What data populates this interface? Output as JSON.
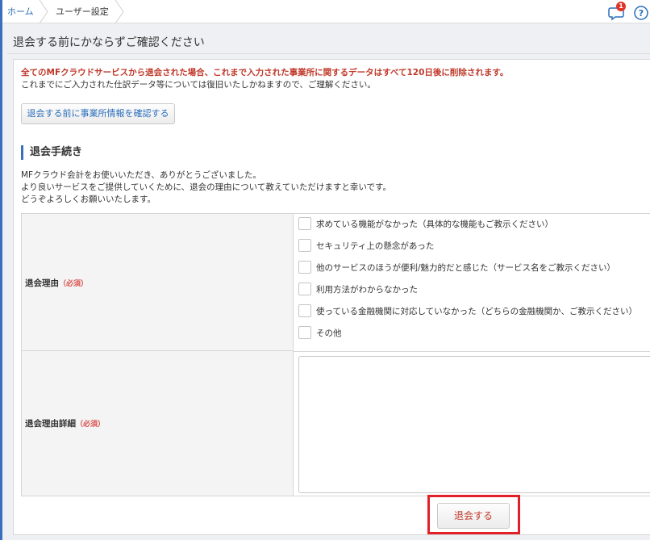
{
  "breadcrumb": {
    "home": "ホーム",
    "current": "ユーザー設定"
  },
  "header": {
    "notification_count": "1",
    "help_label": "?"
  },
  "page": {
    "title": "退会する前にかならずご確認ください"
  },
  "notice": {
    "warning": "全てのMFクラウドサービスから退会された場合、これまで入力された事業所に関するデータはすべて120日後に削除されます。",
    "note": "これまでにご入力された仕訳データ等については復旧いたしかねますので、ご理解ください。",
    "confirm_button": "退会する前に事業所情報を確認する"
  },
  "procedure": {
    "heading": "退会手続き",
    "intro": [
      "MFクラウド会計をお使いいただき、ありがとうございました。",
      "より良いサービスをご提供していくために、退会の理由について教えていただけますと幸いです。",
      "どうぞよろしくお願いいたします。"
    ]
  },
  "form": {
    "reason_label": "退会理由",
    "detail_label": "退会理由詳細",
    "required_mark": "（必須）",
    "reasons": [
      "求めている機能がなかった（具体的な機能もご教示ください）",
      "セキュリティ上の懸念があった",
      "他のサービスのほうが便利/魅力的だと感じた（サービス名をご教示ください）",
      "利用方法がわからなかった",
      "使っている金融機関に対応していなかった（どちらの金融機関か、ご教示ください）",
      "その他"
    ],
    "detail_value": "",
    "submit_label": "退会する"
  },
  "colors": {
    "accent": "#3a6fbf",
    "warning_text": "#c0392b",
    "highlight": "#e2202a"
  }
}
